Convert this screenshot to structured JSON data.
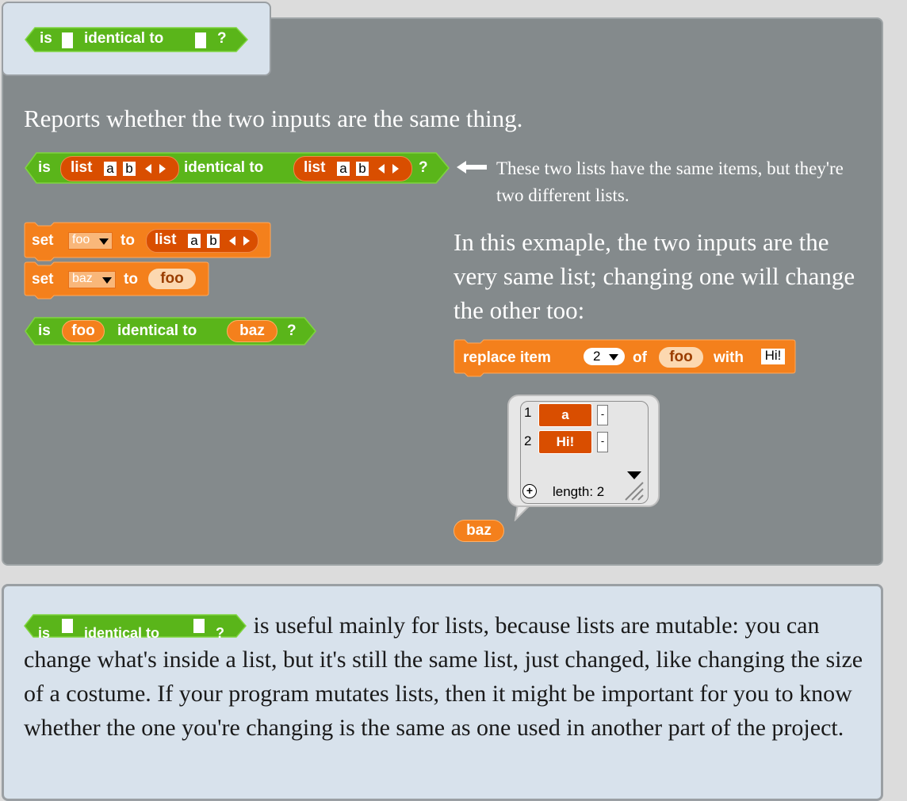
{
  "header": {
    "block": {
      "is": "is",
      "identical": "identical to",
      "q": "?"
    }
  },
  "main": {
    "description": "Reports whether the two inputs are the same thing.",
    "block1": {
      "is": "is",
      "list": "list",
      "a": "a",
      "b": "b",
      "identical": "identical to",
      "q": "?"
    },
    "note": "These two lists have the same items, but they're two different lists.",
    "set1": {
      "set": "set",
      "var": "foo",
      "to": "to",
      "list": "list",
      "a": "a",
      "b": "b"
    },
    "set2": {
      "set": "set",
      "var": "baz",
      "to": "to",
      "value": "foo"
    },
    "block3": {
      "is": "is",
      "left": "foo",
      "identical": "identical to",
      "right": "baz",
      "q": "?"
    },
    "paragraph": "In this exmaple, the two inputs are the very same list; changing one will change the other too:",
    "replace": {
      "replace": "replace item",
      "index": "2",
      "of": "of",
      "var": "foo",
      "with": "with",
      "value": "Hi!"
    },
    "watcher": {
      "items": [
        {
          "index": "1",
          "value": "a"
        },
        {
          "index": "2",
          "value": "Hi!"
        }
      ],
      "minus": "-",
      "plus": "+",
      "length": "length: 2"
    },
    "baz_reporter": "baz"
  },
  "bottom": {
    "block": {
      "is": "is",
      "identical": "identical to",
      "q": "?"
    },
    "text": "is useful mainly for lists, because lists are mutable: you can change what's inside a list, but it's still the same list, just changed, like changing the size of a costume. If your program mutates lists, then it might be important for you to know whether the one you're changing is the same as one used in another part of the project."
  },
  "colors": {
    "predicate_green": "#5ab51a",
    "variables_orange": "#f4801c",
    "list_red": "#d94e00",
    "panel_gray": "#848a8c",
    "tab_blue": "#d8e2ec"
  }
}
